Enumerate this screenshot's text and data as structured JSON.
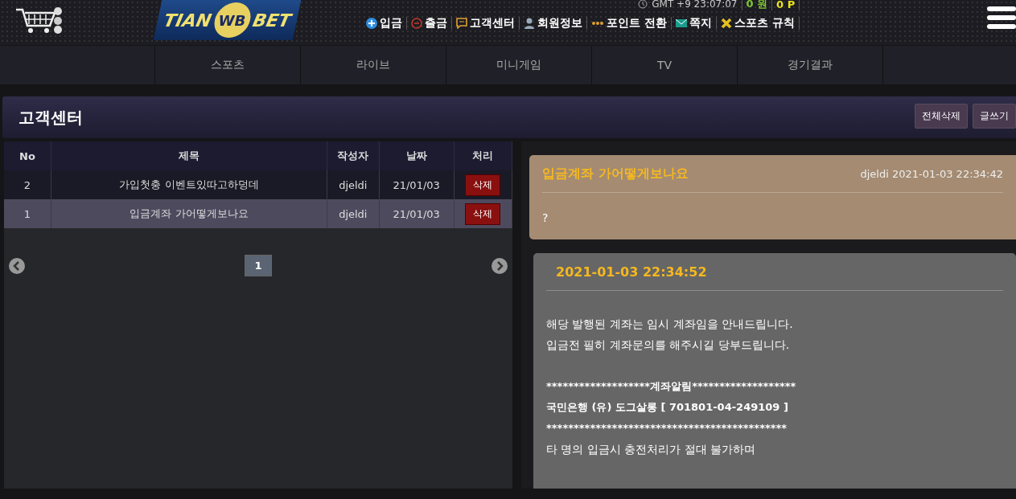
{
  "header": {
    "logo": {
      "left": "TIAN",
      "mark": "WB",
      "right": "BET"
    },
    "clock": "GMT +9 23:07:07",
    "money": "0 원",
    "points": "0 P",
    "links": [
      {
        "label": "입금",
        "kind": "plus"
      },
      {
        "label": "출금",
        "kind": "minus"
      },
      {
        "label": "고객센터",
        "kind": "chat"
      },
      {
        "label": "회원정보",
        "kind": "person"
      },
      {
        "label": "포인트 전환",
        "kind": "dots"
      },
      {
        "label": "쪽지",
        "kind": "mail"
      },
      {
        "label": "스포츠 규칙",
        "kind": "cross"
      }
    ]
  },
  "nav": [
    {
      "label": "스포츠"
    },
    {
      "label": "라이브"
    },
    {
      "label": "미니게임"
    },
    {
      "label": "TV"
    },
    {
      "label": "경기결과"
    }
  ],
  "panel": {
    "title": "고객센터",
    "buttons": [
      "전체삭제",
      "글쓰기"
    ]
  },
  "table": {
    "columns": [
      "No",
      "제목",
      "작성자",
      "날짜",
      "처리"
    ],
    "rows": [
      {
        "no": "2",
        "title": "가입첫충 이벤트있따고하덩데",
        "author": "djeldi",
        "date": "21/01/03",
        "action": "삭제",
        "selected": false
      },
      {
        "no": "1",
        "title": "입금계좌 가어떻게보나요",
        "author": "djeldi",
        "date": "21/01/03",
        "action": "삭제",
        "selected": true
      }
    ],
    "pages": [
      {
        "label": "1",
        "selected": true
      }
    ]
  },
  "messages": [
    {
      "kind": "question",
      "title": "입금계좌 가어떻게보나요",
      "meta": "djeldi 2021-01-03 22:34:42",
      "lines": [
        {
          "text": "?",
          "bold": false,
          "gap_before": false
        }
      ]
    },
    {
      "kind": "answer",
      "title": "2021-01-03 22:34:52",
      "lines": [
        {
          "text": "해당 발행된 계좌는 임시 계좌임을 안내드립니다.",
          "bold": false,
          "gap_before": false
        },
        {
          "text": "입금전 필히 계좌문의를 해주시길 당부드립니다.",
          "bold": false,
          "gap_before": false
        },
        {
          "text": "*******************계좌알림*******************",
          "bold": true,
          "gap_before": true
        },
        {
          "text": "국민은행 (유) 도그살롱 [ 701801-04-249109 ]",
          "bold": true,
          "gap_before": false
        },
        {
          "text": "********************************************",
          "bold": true,
          "gap_before": false
        },
        {
          "text": "타 명의 입금시 충전처리가 절대 불가하며",
          "bold": false,
          "gap_before": false
        }
      ]
    }
  ]
}
